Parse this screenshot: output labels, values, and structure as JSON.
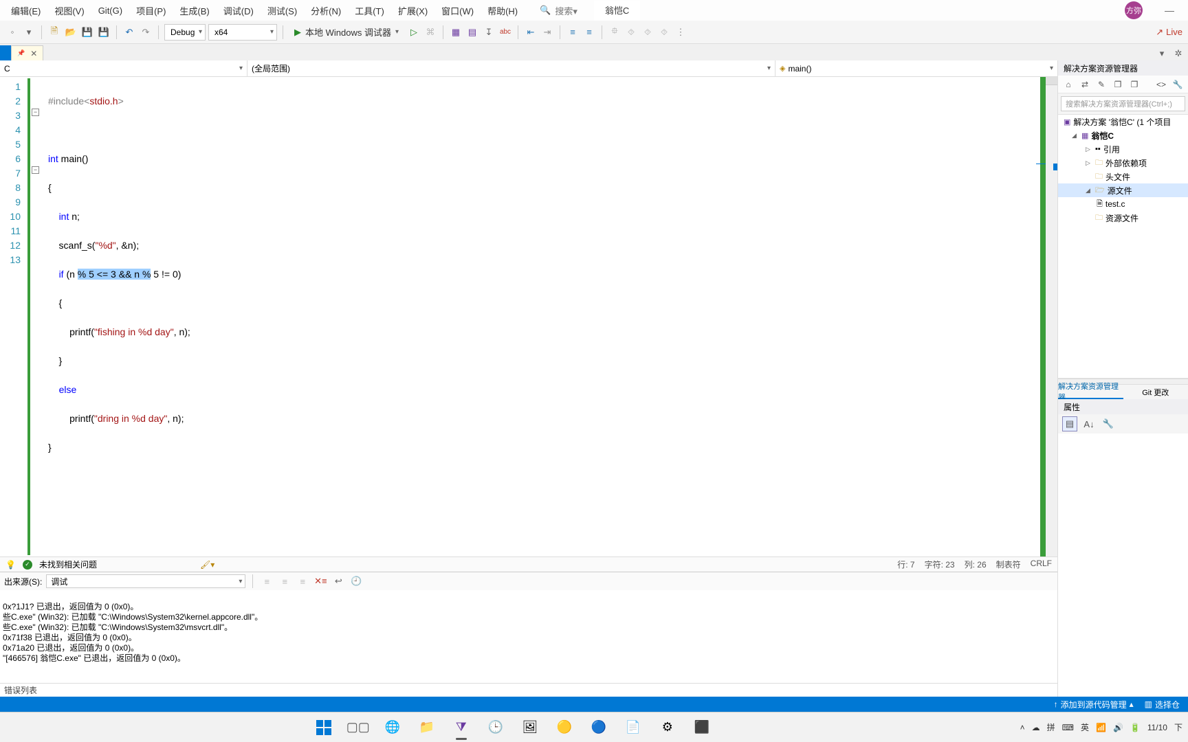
{
  "menu": {
    "items": [
      "编辑(E)",
      "视图(V)",
      "Git(G)",
      "项目(P)",
      "生成(B)",
      "调试(D)",
      "测试(S)",
      "分析(N)",
      "工具(T)",
      "扩展(X)",
      "窗口(W)",
      "帮助(H)"
    ],
    "search_placeholder": "搜索▾",
    "active_doc": "翁恺C",
    "user_badge": "方弥",
    "minimize": "—"
  },
  "toolbar": {
    "config": "Debug",
    "platform": "x64",
    "debugger_label": "本地 Windows 调试器",
    "live": "Live"
  },
  "nav": {
    "left": "C",
    "mid": "(全局范围)",
    "right": "main()"
  },
  "code": {
    "line_numbers": [
      "1",
      "2",
      "3",
      "4",
      "5",
      "6",
      "7",
      "8",
      "9",
      "10",
      "11",
      "12",
      "13"
    ]
  },
  "edstat": {
    "issues": "未找到相关问题",
    "line": "行: 7",
    "char": "字符: 23",
    "col": "列: 26",
    "tabs": "制表符",
    "crlf": "CRLF"
  },
  "se": {
    "title": "解决方案资源管理器",
    "search_placeholder": "搜索解决方案资源管理器(Ctrl+;)",
    "solution": "解决方案 '翁恺C' (1 个项目",
    "project": "翁恺C",
    "refs": "引用",
    "ext": "外部依赖项",
    "hdr": "头文件",
    "src": "源文件",
    "file": "test.c",
    "res": "资源文件",
    "tab_active": "解决方案资源管理器",
    "tab_git": "Git 更改"
  },
  "props": {
    "title": "属性"
  },
  "output": {
    "source_label": "出来源(S):",
    "source_value": "调试",
    "lines": [
      "0x?1J1? 已退出，返回值为 0 (0x0)。",
      "些C.exe\" (Win32): 已加载 \"C:\\Windows\\System32\\kernel.appcore.dll\"。",
      "些C.exe\" (Win32): 已加载 \"C:\\Windows\\System32\\msvcrt.dll\"。",
      "0x71f38 已退出，返回值为 0 (0x0)。",
      "0x71a20 已退出，返回值为 0 (0x0)。",
      "\"[466576] 翁恺C.exe\" 已退出，返回值为 0 (0x0)。"
    ]
  },
  "errlist": {
    "title": "错误列表"
  },
  "vs_status": {
    "scm": "添加到源代码管理",
    "repo": "选择仓"
  },
  "tray": {
    "ime1": "拼",
    "ime2": "英",
    "date": "11/10",
    "down": "下"
  }
}
